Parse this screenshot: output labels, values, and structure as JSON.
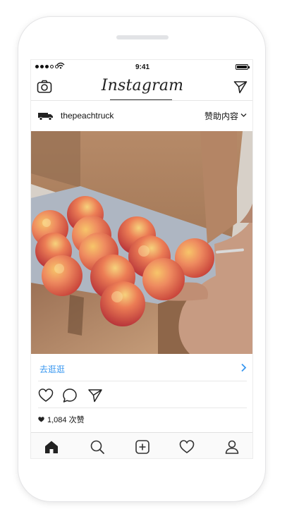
{
  "status_bar": {
    "time": "9:41",
    "battery_level": 1.0
  },
  "top_bar": {
    "logo_text": "Instagram"
  },
  "post": {
    "username": "thepeachtruck",
    "sponsored_label": "赞助内容",
    "cta_label": "去逛逛",
    "likes_text": "1,084 次赞",
    "image_subject": "box of ripe peaches held by hands"
  },
  "colors": {
    "cta_blue": "#3897f0",
    "peach": "#e9785e",
    "cardboard": "#b88660"
  },
  "icons": {
    "camera": "camera-icon",
    "direct": "send-icon",
    "truck": "truck-icon",
    "like": "heart-icon",
    "comment": "comment-icon",
    "share": "send-icon",
    "home": "home-icon",
    "search": "search-icon",
    "add": "add-icon",
    "activity": "heart-icon",
    "profile": "profile-icon"
  }
}
